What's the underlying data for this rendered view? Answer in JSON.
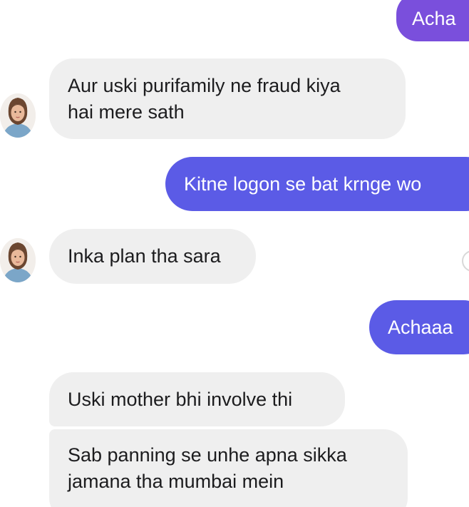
{
  "colors": {
    "outgoing_top": "#7a4fdc",
    "outgoing": "#5b5be6",
    "incoming": "#efefef",
    "incoming_text": "#1c1c1e",
    "outgoing_text": "#ffffff"
  },
  "contact": {
    "avatar_icon": "profile-photo-woman"
  },
  "messages": [
    {
      "direction": "outgoing",
      "lines": [
        "Acha"
      ]
    },
    {
      "direction": "incoming",
      "lines": [
        "Aur uski purifamily ne fraud kiya",
        "hai mere sath"
      ]
    },
    {
      "direction": "outgoing",
      "lines": [
        "Kitne logon se bat krnge wo"
      ]
    },
    {
      "direction": "incoming",
      "lines": [
        "Inka plan tha sara"
      ]
    },
    {
      "direction": "outgoing",
      "lines": [
        "Achaaa"
      ]
    },
    {
      "direction": "incoming",
      "lines": [
        "Uski mother bhi involve thi"
      ]
    },
    {
      "direction": "incoming",
      "lines": [
        "Sab panning se unhe apna sikka",
        "jamana tha mumbai mein"
      ]
    }
  ]
}
